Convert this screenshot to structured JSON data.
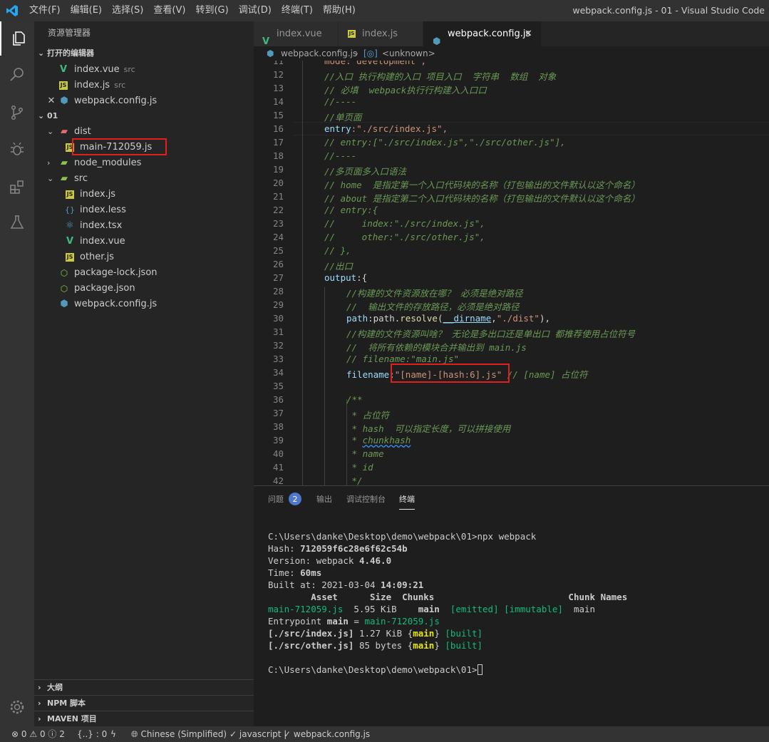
{
  "titlebar": {
    "menus": [
      "文件(F)",
      "编辑(E)",
      "选择(S)",
      "查看(V)",
      "转到(G)",
      "调试(D)",
      "终端(T)",
      "帮助(H)"
    ],
    "window_title": "webpack.config.js - 01 - Visual Studio Code"
  },
  "activitybar": {
    "items": [
      "files-icon",
      "search-icon",
      "source-control-icon",
      "debug-icon",
      "extensions-icon",
      "test-icon"
    ],
    "settings_badge": "1"
  },
  "sidebar": {
    "title": "资源管理器",
    "open_editors": {
      "header": "打开的编辑器",
      "items": [
        {
          "name": "index.vue",
          "desc": "src"
        },
        {
          "name": "index.js",
          "desc": "src"
        },
        {
          "name": "webpack.config.js",
          "desc": ""
        }
      ]
    },
    "folder": {
      "header": "01",
      "items": [
        {
          "name": "dist"
        },
        {
          "name": "main-712059.js"
        },
        {
          "name": "node_modules"
        },
        {
          "name": "src"
        },
        {
          "name": "index.js"
        },
        {
          "name": "index.less"
        },
        {
          "name": "index.tsx"
        },
        {
          "name": "index.vue"
        },
        {
          "name": "other.js"
        },
        {
          "name": "package-lock.json"
        },
        {
          "name": "package.json"
        },
        {
          "name": "webpack.config.js"
        }
      ]
    },
    "bottom_sections": [
      "大纲",
      "NPM 脚本",
      "MAVEN 项目"
    ]
  },
  "tabs": [
    {
      "label": "index.vue"
    },
    {
      "label": "index.js"
    },
    {
      "label": "webpack.config.js"
    }
  ],
  "breadcrumb": {
    "file": "webpack.config.js",
    "symbol": "<unknown>"
  },
  "code": {
    "line_numbers": [
      "11",
      "12",
      "13",
      "14",
      "15",
      "16",
      "17",
      "18",
      "19",
      "20",
      "21",
      "22",
      "23",
      "24",
      "25",
      "26",
      "27",
      "28",
      "29",
      "30",
      "31",
      "32",
      "33",
      "34",
      "35",
      "36",
      "37",
      "38",
      "39",
      "40",
      "41",
      "42"
    ],
    "lines": {
      "l11": "mode:\"development\",",
      "l12": "//入口 执行构建的入口 项目入口  字符串  数组  对象",
      "l13": "// 必填  webpack执行行构建入入口口",
      "l14": "//----",
      "l15": "//单页面",
      "l16a": "entry",
      "l16b": ":\"./src/index.js\",",
      "l17": "// entry:[\"./src/index.js\",\"./src/other.js\"],",
      "l18": "//----",
      "l19": "//多页面多入口语法",
      "l20": "// home  是指定第一个入口代码块的名称（打包输出的文件默认以这个命名）",
      "l21": "// about 是指定第二个入口代码块的名称（打包输出的文件默认以这个命名）",
      "l22": "// entry:{",
      "l23": "//     index:\"./src/index.js\",",
      "l24": "//     other:\"./src/other.js\",",
      "l25": "// },",
      "l26": "//出口",
      "l27a": "output",
      "l27b": ":{",
      "l28": "//构建的文件资源放在哪？ 必须是绝对路径",
      "l29": "//  输出文件的存放路径，必须是绝对路径",
      "l30a": "path",
      "l30b": ":path.",
      "l30c": "resolve",
      "l30d": "(",
      "l30e": "__dirname",
      "l30f": ",",
      "l30g": "\"./dist\"",
      "l30h": "),",
      "l31": "//构建的文件资源叫啥？ 无论是多出口还是单出口 都推荐使用占位符号",
      "l32": "//  将所有依赖的模块合并输出到 main.js",
      "l33": "// filename:\"main.js\"",
      "l34a": "filename",
      "l34b": ":",
      "l34c": "\"[name]-[hash:6].js\"",
      "l34d": " // [name] 占位符",
      "l36": "/**",
      "l37": " * 占位符",
      "l38": " * hash  可以指定长度，可以拼接使用",
      "l39a": " * ",
      "l39b": "chunkhash",
      "l40": " * name",
      "l41": " * id",
      "l42": " */"
    }
  },
  "panel": {
    "tabs": [
      "问题",
      "输出",
      "调试控制台",
      "终端"
    ],
    "problems_count": "2",
    "terminal": {
      "prompt1": "C:\\Users\\danke\\Desktop\\demo\\webpack\\01>npx webpack",
      "hash_label": "Hash: ",
      "hash": "712059f6c28e6f62c54b",
      "version_label": "Version: webpack ",
      "version": "4.46.0",
      "time_label": "Time: ",
      "time": "60ms",
      "built_label": "Built at: 2021-03-04 ",
      "built_time": "14:09:21",
      "header": "        Asset      Size  Chunks                         Chunk Names",
      "asset": "main-712059.js",
      "asset_size": "  5.95 KiB    ",
      "asset_chunk": "main",
      "asset_flags": "  [emitted] [immutable]  ",
      "asset_chunkname": "main",
      "entry_label": "Entrypoint ",
      "entry_main": "main",
      "entry_eq": " = ",
      "entry_file": "main-712059.js",
      "m1_path": "[./src/index.js]",
      "m1_size": " 1.27 KiB ",
      "m1_chunk": "main",
      "m1_built": "[built]",
      "m2_path": "[./src/other.js]",
      "m2_size": " 85 bytes ",
      "m2_chunk": "main",
      "m2_built": "[built]",
      "prompt2": "C:\\Users\\danke\\Desktop\\demo\\webpack\\01>"
    }
  },
  "statusbar": {
    "errors": "0",
    "warnings": "0",
    "info": "2",
    "braces": "{..} : 0",
    "language": "Chinese (Simplified)",
    "mode": "javascript",
    "file": "webpack.config.js"
  },
  "colors": {
    "accent": "#007acc",
    "highlight_box": "#e0201e",
    "terminal_green": "#0dbc79",
    "terminal_yellow": "#e5e510"
  }
}
